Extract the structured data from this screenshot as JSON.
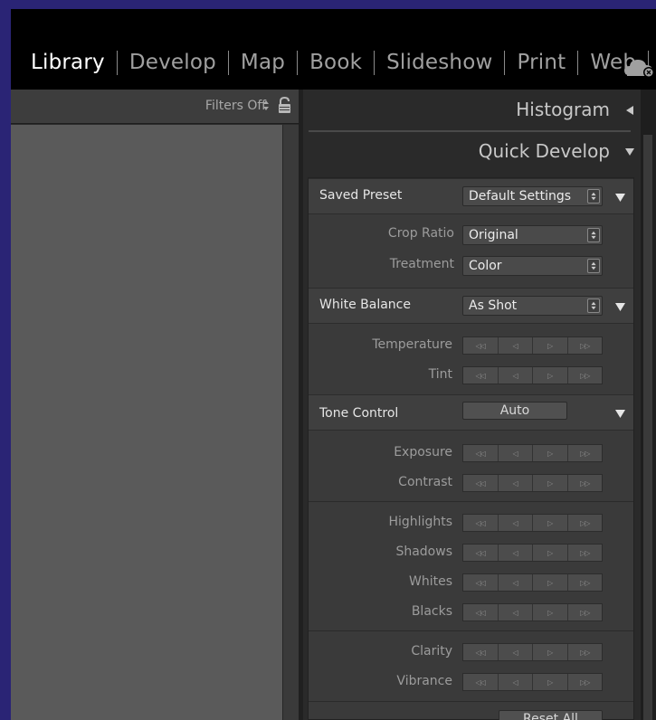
{
  "modules": [
    "Library",
    "Develop",
    "Map",
    "Book",
    "Slideshow",
    "Print",
    "Web"
  ],
  "active_module": "Library",
  "filter_bar": {
    "label": "Filters Off"
  },
  "right_panel": {
    "histogram_title": "Histogram",
    "quick_develop_title": "Quick Develop",
    "saved_preset": {
      "label": "Saved Preset",
      "value": "Default Settings"
    },
    "crop_ratio": {
      "label": "Crop Ratio",
      "value": "Original"
    },
    "treatment": {
      "label": "Treatment",
      "value": "Color"
    },
    "white_balance": {
      "label": "White Balance",
      "value": "As Shot"
    },
    "wb_rows": [
      "Temperature",
      "Tint"
    ],
    "tone_control": {
      "label": "Tone Control",
      "auto_label": "Auto"
    },
    "tone_rows_a": [
      "Exposure",
      "Contrast"
    ],
    "tone_rows_b": [
      "Highlights",
      "Shadows",
      "Whites",
      "Blacks"
    ],
    "tone_rows_c": [
      "Clarity",
      "Vibrance"
    ],
    "reset_label": "Reset All",
    "stepper_glyphs": [
      "◁◁",
      "◁",
      "▷",
      "▷▷"
    ]
  },
  "colors": {
    "frame": "#2a2475",
    "topbar": "#000000",
    "grid_bg": "#5a5a5a",
    "panel_bg": "#3a3a3a"
  }
}
